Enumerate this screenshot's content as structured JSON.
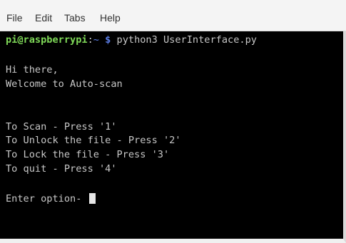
{
  "menu": {
    "items": [
      "File",
      "Edit",
      "Tabs",
      "Help"
    ]
  },
  "terminal": {
    "prompt": {
      "user_host": "pi@raspberrypi",
      "separator": ":",
      "path": "~",
      "dollar": "$",
      "command": "python3 UserInterface.py"
    },
    "lines": [
      "Hi there,",
      "Welcome to Auto-scan",
      "To Scan - Press '1'",
      "To Unlock the file - Press '2'",
      "To Lock the file - Press '3'",
      "To quit - Press '4'",
      "Enter option- "
    ]
  },
  "colors": {
    "background": "#000000",
    "text": "#c8c8c8",
    "user_host": "#7fd958",
    "path": "#5c7fe8"
  }
}
